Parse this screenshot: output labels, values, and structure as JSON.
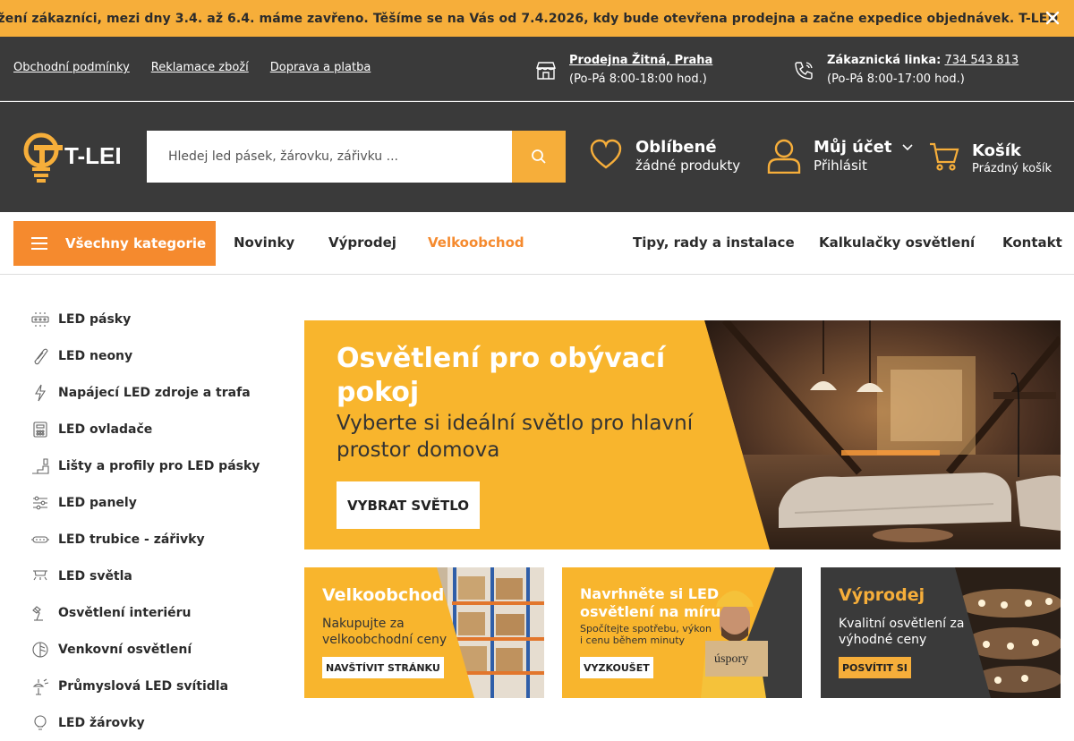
{
  "announcement": {
    "text": "Vážení zákazníci, mezi dny 3.4. až 6.4. máme zavřeno. Těšíme se na Vás od 7.4.2026, kdy bude otevřena prodejna a začne expedice objednávek. T-LED",
    "close_icon": "close-icon"
  },
  "infobar": {
    "links": [
      "Obchodní podmínky",
      "Reklamace zboží",
      "Doprava a platba"
    ],
    "store": {
      "name": "Prodejna Žitná, Praha",
      "hours": "(Po-Pá 8:00-18:00 hod.)",
      "icon": "store-icon"
    },
    "phone": {
      "label": "Zákaznická linka:",
      "number": "734 543 813",
      "hours": "(Po-Pá 8:00-17:00 hod.)",
      "icon": "phone-icon"
    }
  },
  "header": {
    "logo_text": "T-LED",
    "search_placeholder": "Hledej led pásek, žárovku, zářivku ...",
    "favorites": {
      "title": "Oblíbené",
      "sub": "žádné produkty"
    },
    "account": {
      "title": "Můj účet",
      "sub": "Přihlásit"
    },
    "cart": {
      "title": "Košík",
      "sub": "Prázdný košík"
    }
  },
  "nav": {
    "all_categories": "Všechny kategorie",
    "links": [
      "Novinky",
      "Výprodej",
      "Velkoobchod",
      "Tipy, rady a instalace",
      "Kalkulačky osvětlení",
      "Kontakt"
    ]
  },
  "sidebar": {
    "items": [
      "LED pásky",
      "LED neony",
      "Napájecí LED zdroje a trafa",
      "LED ovladače",
      "Lišty a profily pro LED pásky",
      "LED panely",
      "LED trubice - zářivky",
      "LED světla",
      "Osvětlení interiéru",
      "Venkovní osvětlení",
      "Průmyslová LED svítidla",
      "LED žárovky"
    ]
  },
  "hero": {
    "title": "Osvětlení pro obývací pokoj",
    "subtitle": "Vyberte si ideální světlo pro hlavní prostor domova",
    "button": "VYBRAT SVĚTLO"
  },
  "tiles": [
    {
      "title": "Velkoobchod",
      "text": "Nakupujte za velkoobchodní ceny",
      "button": "NAVŠTÍVIT STRÁNKU"
    },
    {
      "title": "Navrhněte si LED osvětlení na míru",
      "text": "Spočítejte spotřebu, výkon i cenu během minuty",
      "button": "VYZKOUŠET",
      "sign": "úspory"
    },
    {
      "title": "Výprodej",
      "text": "Kvalitní osvětlení za výhodné ceny",
      "button": "POSVÍTIT SI"
    }
  ],
  "colors": {
    "accent": "#f6ae3a",
    "orange": "#f58a2e",
    "dark": "#3a3a3a",
    "yellow": "#f8b52d"
  }
}
